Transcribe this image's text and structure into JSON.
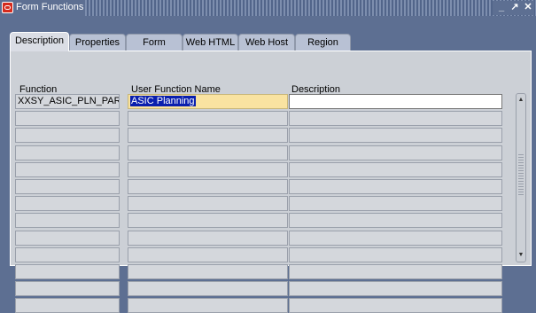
{
  "window": {
    "title": "Form Functions",
    "controls": [
      "_",
      "↗",
      "✕"
    ]
  },
  "tabs": [
    "Description",
    "Properties",
    "Form",
    "Web HTML",
    "Web Host",
    "Region"
  ],
  "active_tab": "Description",
  "columns": {
    "function": "Function",
    "user_function_name": "User Function Name",
    "description": "Description"
  },
  "rows": [
    {
      "function": "XXSY_ASIC_PLN_PARA",
      "user_function_name": "ASIC Planning",
      "description": ""
    },
    {
      "function": "",
      "user_function_name": "",
      "description": ""
    },
    {
      "function": "",
      "user_function_name": "",
      "description": ""
    },
    {
      "function": "",
      "user_function_name": "",
      "description": ""
    },
    {
      "function": "",
      "user_function_name": "",
      "description": ""
    },
    {
      "function": "",
      "user_function_name": "",
      "description": ""
    },
    {
      "function": "",
      "user_function_name": "",
      "description": ""
    },
    {
      "function": "",
      "user_function_name": "",
      "description": ""
    },
    {
      "function": "",
      "user_function_name": "",
      "description": ""
    },
    {
      "function": "",
      "user_function_name": "",
      "description": ""
    },
    {
      "function": "",
      "user_function_name": "",
      "description": ""
    },
    {
      "function": "",
      "user_function_name": "",
      "description": ""
    },
    {
      "function": "",
      "user_function_name": "",
      "description": ""
    }
  ],
  "colors": {
    "frame": "#5d6f92",
    "tab": "#b8c1d4",
    "content": "#ccd0d6",
    "current_field": "#f9e3a1",
    "selection": "#0a1fae"
  }
}
